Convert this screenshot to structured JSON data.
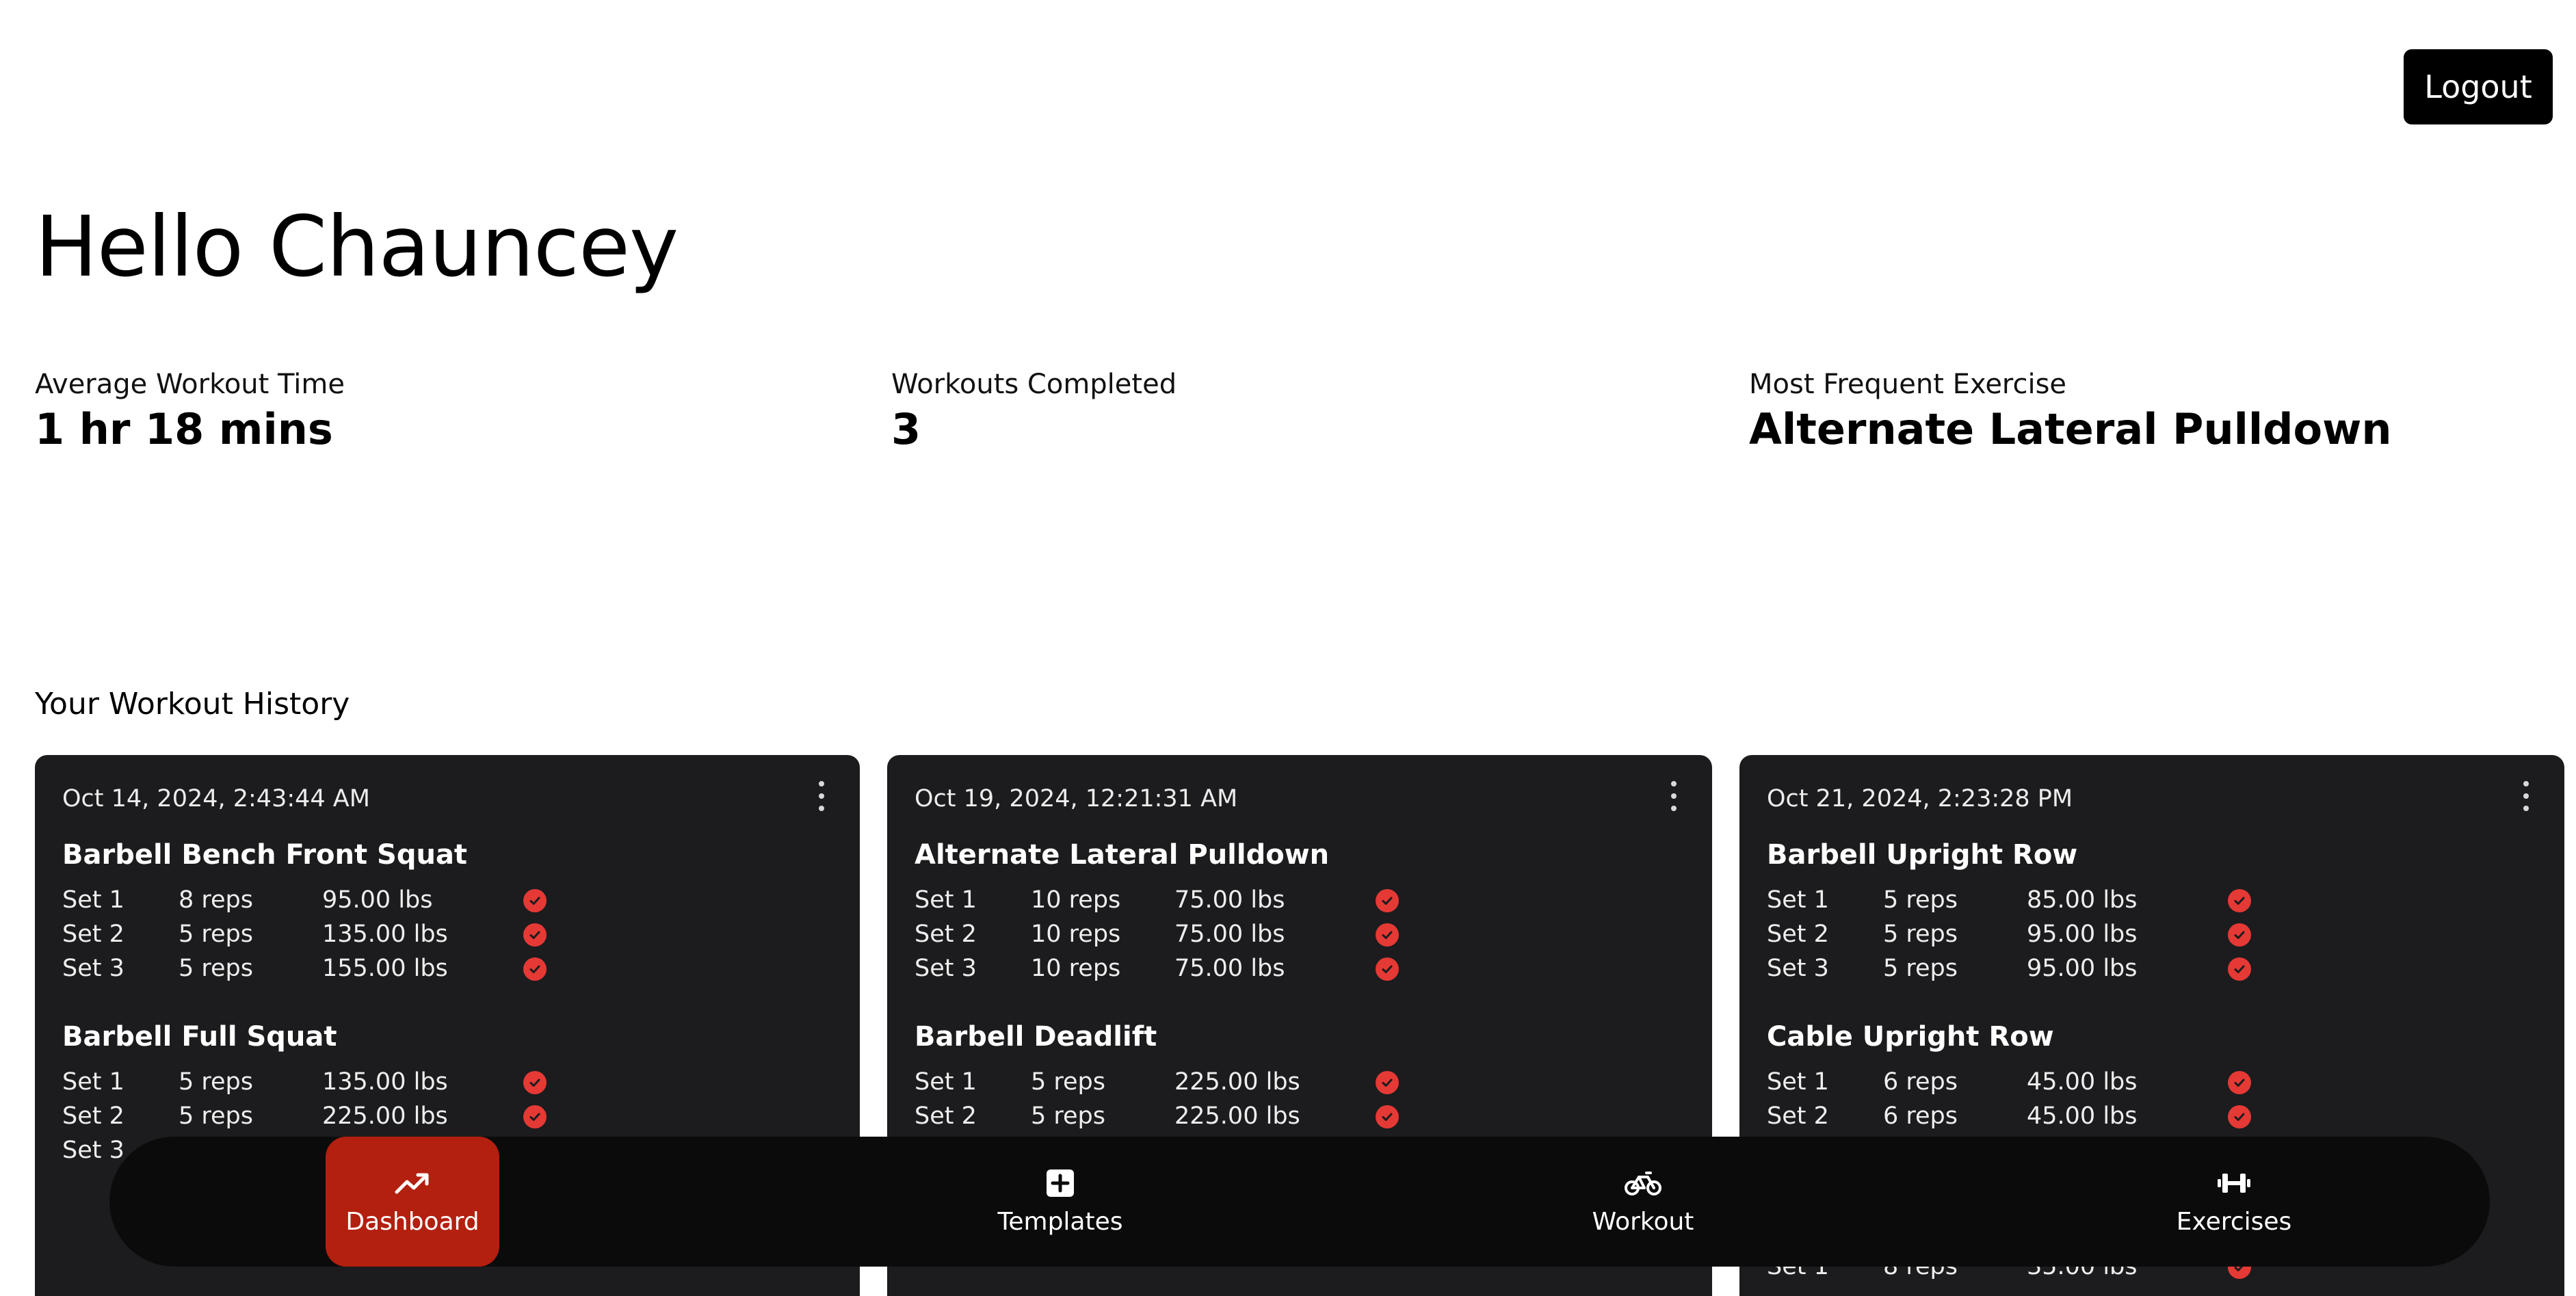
{
  "header": {
    "logout_label": "Logout"
  },
  "greeting": "Hello Chauncey",
  "stats": [
    {
      "label": "Average Workout Time",
      "value": "1 hr 18 mins"
    },
    {
      "label": "Workouts Completed",
      "value": "3"
    },
    {
      "label": "Most Frequent Exercise",
      "value": "Alternate Lateral Pulldown"
    }
  ],
  "history": {
    "title": "Your Workout History",
    "cards": [
      {
        "date": "Oct 14, 2024, 2:43:44 AM",
        "exercises": [
          {
            "name": "Barbell Bench Front Squat",
            "sets": [
              {
                "set": "Set 1",
                "reps": "8 reps",
                "weight": "95.00 lbs"
              },
              {
                "set": "Set 2",
                "reps": "5 reps",
                "weight": "135.00 lbs"
              },
              {
                "set": "Set 3",
                "reps": "5 reps",
                "weight": "155.00 lbs"
              }
            ]
          },
          {
            "name": "Barbell Full Squat",
            "sets": [
              {
                "set": "Set 1",
                "reps": "5 reps",
                "weight": "135.00 lbs"
              },
              {
                "set": "Set 2",
                "reps": "5 reps",
                "weight": "225.00 lbs"
              },
              {
                "set": "Set 3",
                "reps": "",
                "weight": ""
              }
            ]
          }
        ]
      },
      {
        "date": "Oct 19, 2024, 12:21:31 AM",
        "exercises": [
          {
            "name": "Alternate Lateral Pulldown",
            "sets": [
              {
                "set": "Set 1",
                "reps": "10 reps",
                "weight": "75.00 lbs"
              },
              {
                "set": "Set 2",
                "reps": "10 reps",
                "weight": "75.00 lbs"
              },
              {
                "set": "Set 3",
                "reps": "10 reps",
                "weight": "75.00 lbs"
              }
            ]
          },
          {
            "name": "Barbell Deadlift",
            "sets": [
              {
                "set": "Set 1",
                "reps": "5 reps",
                "weight": "225.00 lbs"
              },
              {
                "set": "Set 2",
                "reps": "5 reps",
                "weight": "225.00 lbs"
              }
            ]
          }
        ]
      },
      {
        "date": "Oct 21, 2024, 2:23:28 PM",
        "exercises": [
          {
            "name": "Barbell Upright Row",
            "sets": [
              {
                "set": "Set 1",
                "reps": "5 reps",
                "weight": "85.00 lbs"
              },
              {
                "set": "Set 2",
                "reps": "5 reps",
                "weight": "95.00 lbs"
              },
              {
                "set": "Set 3",
                "reps": "5 reps",
                "weight": "95.00 lbs"
              }
            ]
          },
          {
            "name": "Cable Upright Row",
            "sets": [
              {
                "set": "Set 1",
                "reps": "6 reps",
                "weight": "45.00 lbs"
              },
              {
                "set": "Set 2",
                "reps": "6 reps",
                "weight": "45.00 lbs"
              }
            ]
          },
          {
            "name": "",
            "sets": [
              {
                "set": "Set 1",
                "reps": "8 reps",
                "weight": "35.00 lbs"
              }
            ]
          }
        ]
      }
    ]
  },
  "nav": {
    "items": [
      {
        "label": "Dashboard",
        "icon": "trending-up-icon",
        "active": true
      },
      {
        "label": "Templates",
        "icon": "plus-square-icon",
        "active": false
      },
      {
        "label": "Workout",
        "icon": "bicycle-icon",
        "active": false
      },
      {
        "label": "Exercises",
        "icon": "dumbbell-icon",
        "active": false
      }
    ]
  },
  "colors": {
    "accent": "#b3200f",
    "check": "#e53935",
    "card_bg": "#1c1c1e",
    "nav_bg": "#0b0b0c"
  }
}
